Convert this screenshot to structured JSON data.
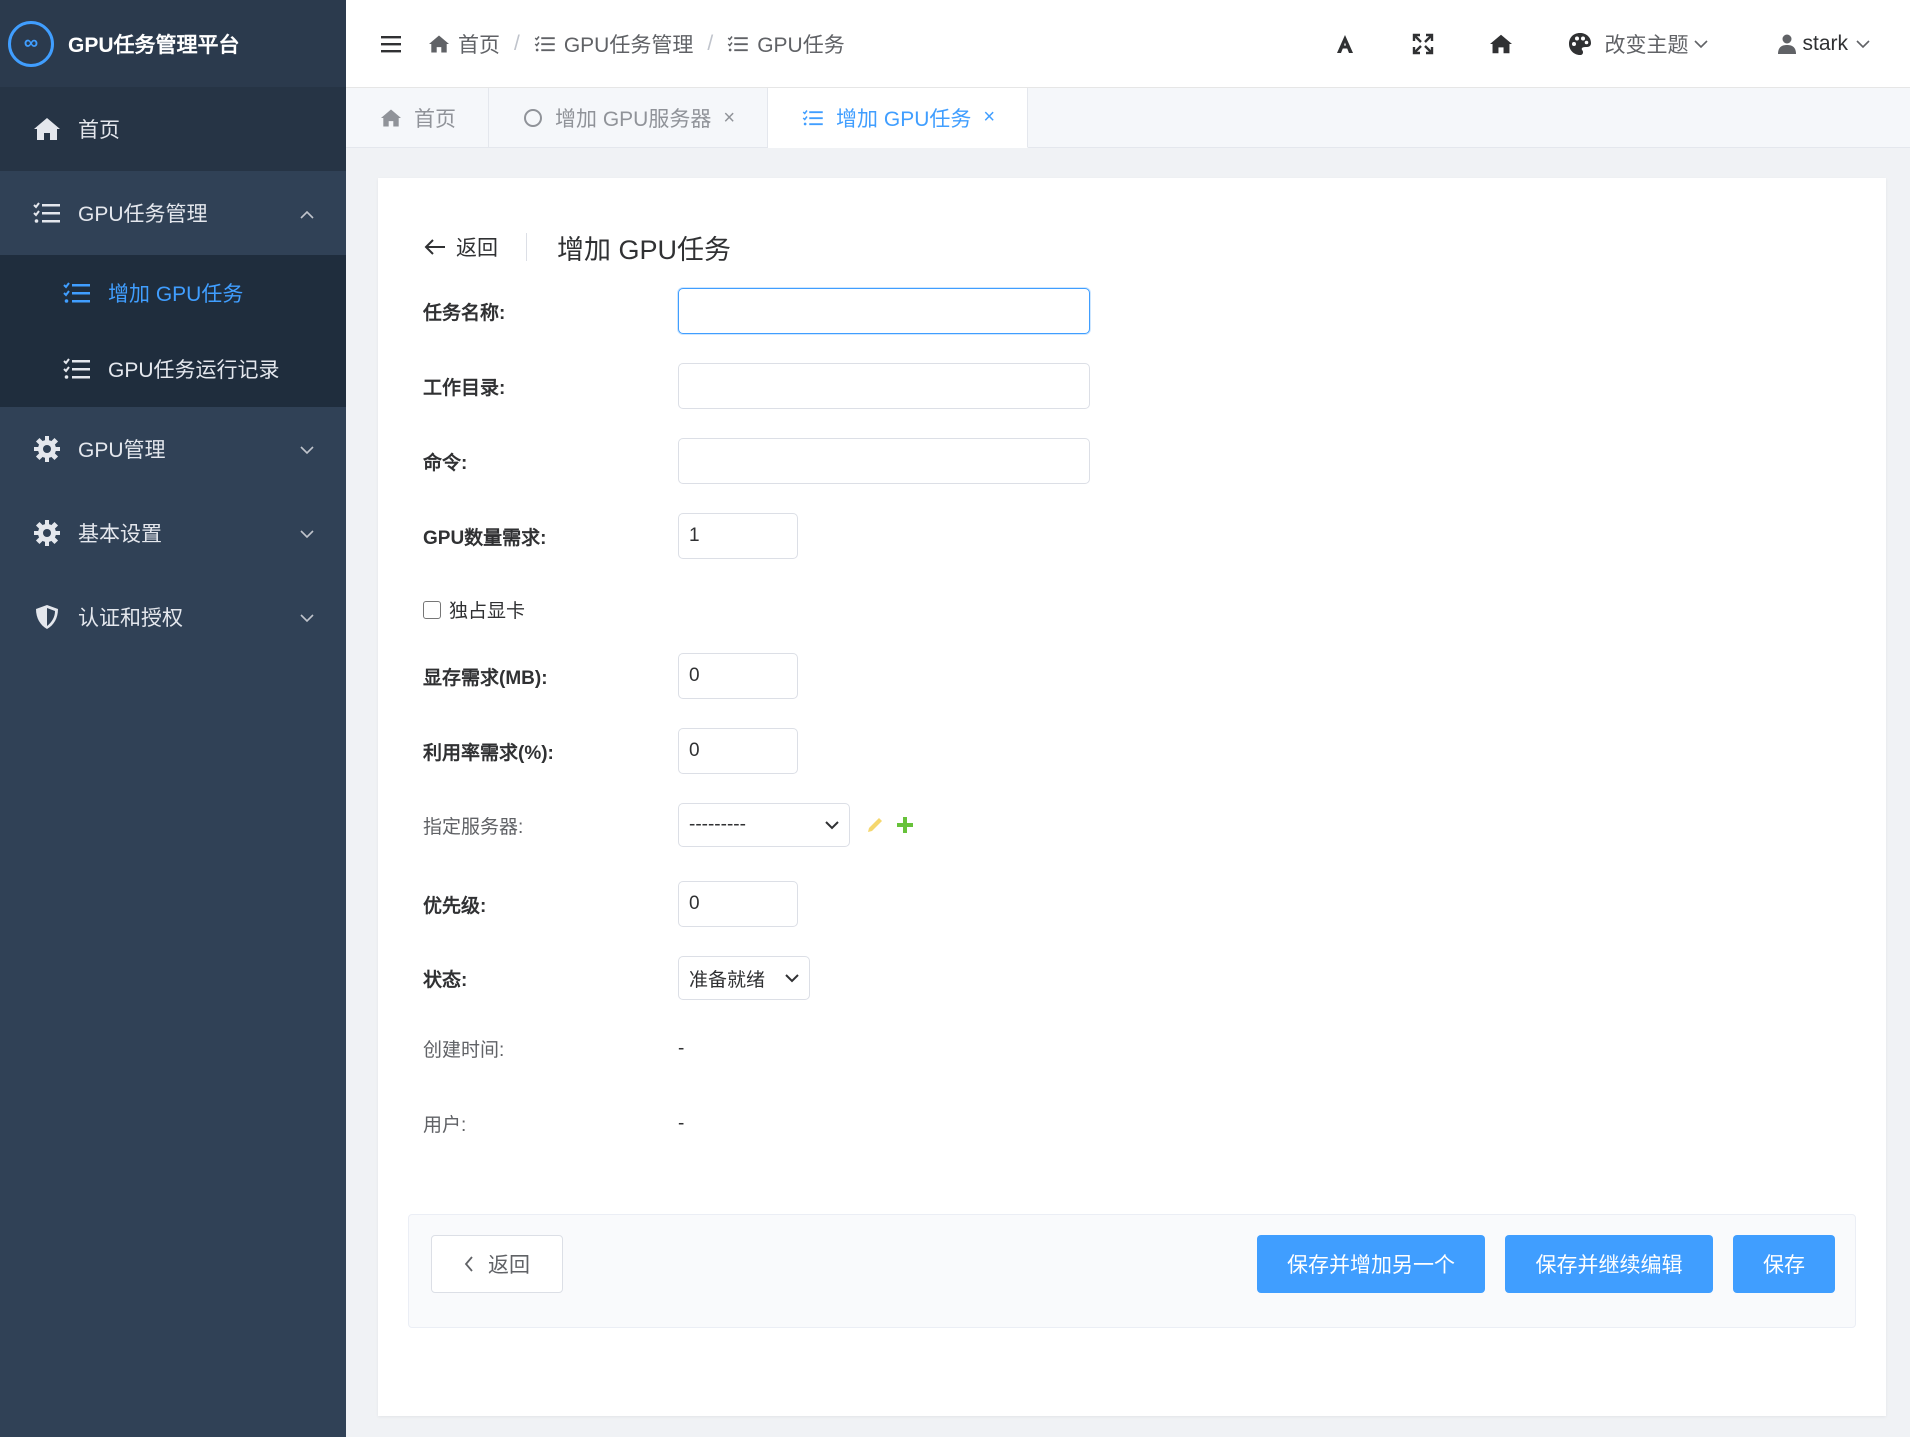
{
  "app": {
    "logo_glyph": "∞",
    "title": "GPU任务管理平台"
  },
  "sidebar": {
    "home": "首页",
    "gpu_task_mgmt": "GPU任务管理",
    "sub_add_task": "增加 GPU任务",
    "sub_task_records": "GPU任务运行记录",
    "gpu_mgmt": "GPU管理",
    "basic_settings": "基本设置",
    "auth": "认证和授权"
  },
  "header": {
    "breadcrumb": [
      "首页",
      "GPU任务管理",
      "GPU任务"
    ],
    "breadcrumb_sep": "/",
    "theme_label": "改变主题",
    "user_name": "stark"
  },
  "tabs": [
    {
      "label": "首页"
    },
    {
      "label": "增加 GPU服务器",
      "close": "×"
    },
    {
      "label": "增加 GPU任务",
      "close": "×"
    }
  ],
  "page": {
    "back_label": "返回",
    "title": "增加 GPU任务"
  },
  "form": {
    "name_label": "任务名称:",
    "name_value": "",
    "workdir_label": "工作目录:",
    "workdir_value": "",
    "cmd_label": "命令:",
    "cmd_value": "",
    "gpu_count_label": "GPU数量需求:",
    "gpu_count_value": "1",
    "exclusive_label": "独占显卡",
    "mem_label": "显存需求(MB):",
    "mem_value": "0",
    "util_label": "利用率需求(%):",
    "util_value": "0",
    "server_label": "指定服务器:",
    "server_value": "---------",
    "priority_label": "优先级:",
    "priority_value": "0",
    "status_label": "状态:",
    "status_value": "准备就绪",
    "created_label": "创建时间:",
    "created_value": "-",
    "user_label": "用户:",
    "user_value": "-"
  },
  "footer": {
    "back": "返回",
    "save_add": "保存并增加另一个",
    "save_continue": "保存并继续编辑",
    "save": "保存"
  },
  "colors": {
    "sidebar_bg": "#304156",
    "accent": "#409eff",
    "edit_icon": "#f5d76e",
    "add_icon": "#67c23a"
  }
}
